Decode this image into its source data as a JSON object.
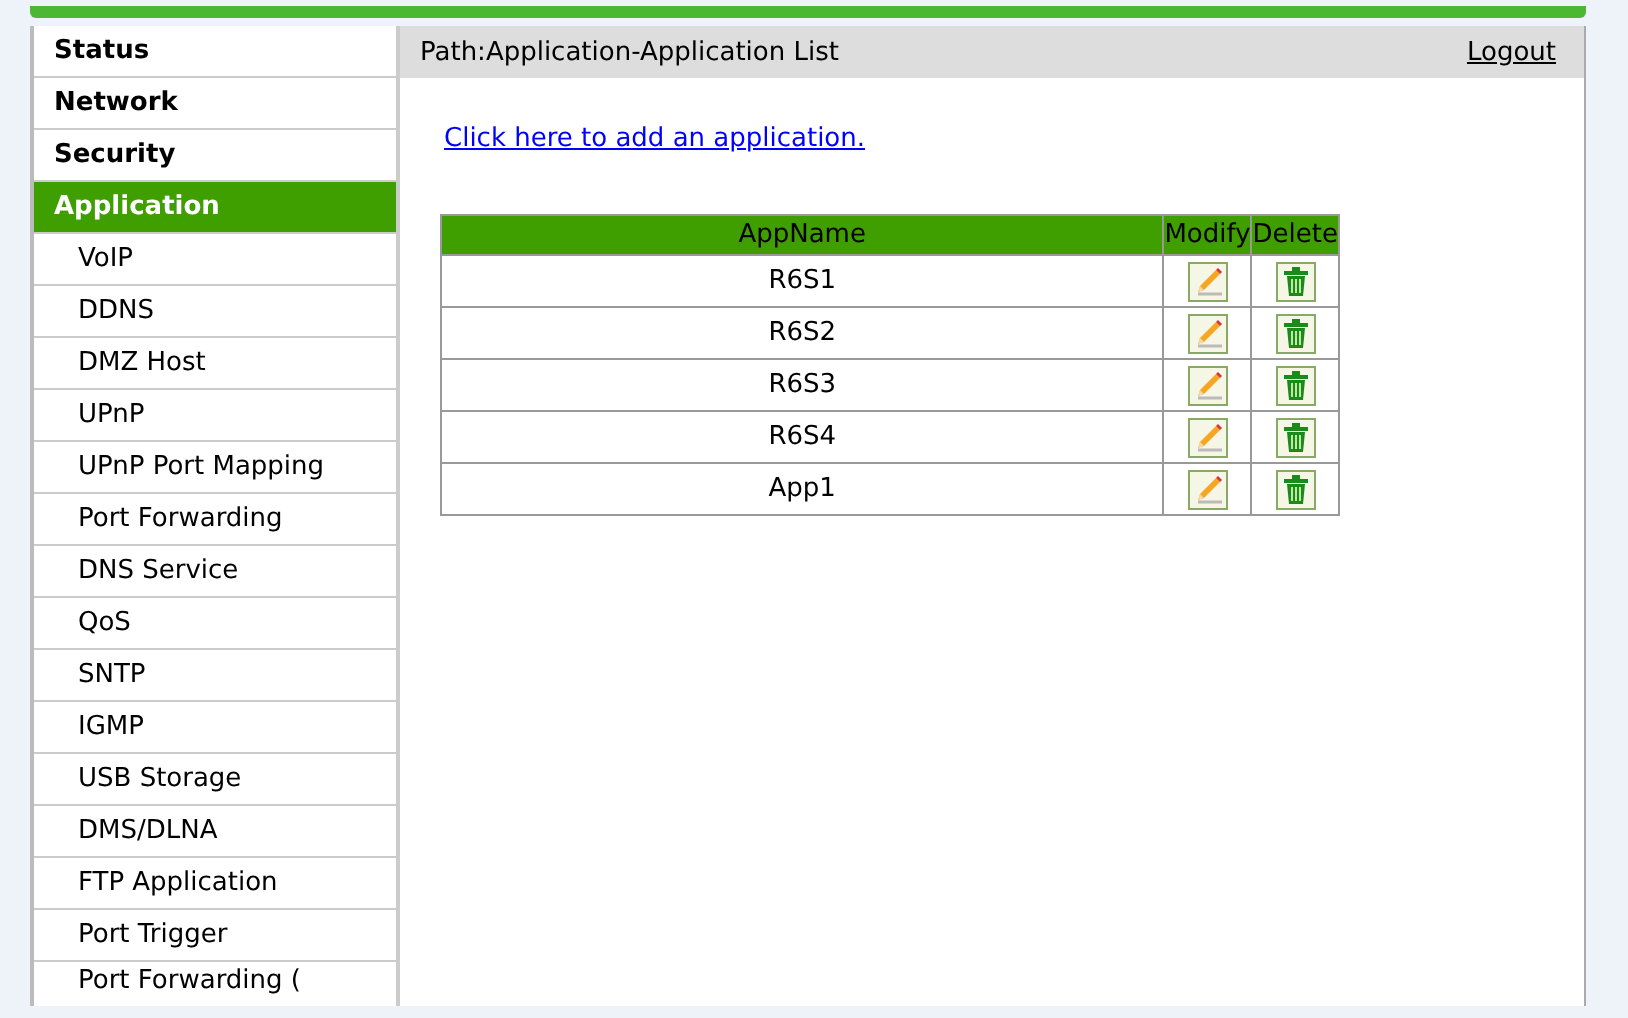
{
  "sidebar": {
    "items": [
      {
        "label": "Status",
        "kind": "section",
        "selected": false
      },
      {
        "label": "Network",
        "kind": "section",
        "selected": false
      },
      {
        "label": "Security",
        "kind": "section",
        "selected": false
      },
      {
        "label": "Application",
        "kind": "section",
        "selected": true
      },
      {
        "label": "VoIP",
        "kind": "sub",
        "selected": false
      },
      {
        "label": "DDNS",
        "kind": "sub",
        "selected": false
      },
      {
        "label": "DMZ Host",
        "kind": "sub",
        "selected": false
      },
      {
        "label": "UPnP",
        "kind": "sub",
        "selected": false
      },
      {
        "label": "UPnP Port Mapping",
        "kind": "sub",
        "selected": false
      },
      {
        "label": "Port Forwarding",
        "kind": "sub",
        "selected": false
      },
      {
        "label": "DNS Service",
        "kind": "sub",
        "selected": false
      },
      {
        "label": "QoS",
        "kind": "sub",
        "selected": false
      },
      {
        "label": "SNTP",
        "kind": "sub",
        "selected": false
      },
      {
        "label": "IGMP",
        "kind": "sub",
        "selected": false
      },
      {
        "label": "USB Storage",
        "kind": "sub",
        "selected": false
      },
      {
        "label": "DMS/DLNA",
        "kind": "sub",
        "selected": false
      },
      {
        "label": "FTP Application",
        "kind": "sub",
        "selected": false
      },
      {
        "label": "Port Trigger",
        "kind": "sub",
        "selected": false
      },
      {
        "label": "Port Forwarding (",
        "kind": "sub",
        "selected": false
      }
    ]
  },
  "header": {
    "path": "Path:Application-Application List",
    "logout": "Logout"
  },
  "add_link": "Click here to add an application.",
  "table": {
    "columns": [
      "AppName",
      "Modify",
      "Delete"
    ],
    "rows": [
      {
        "name": "R6S1"
      },
      {
        "name": "R6S2"
      },
      {
        "name": "R6S3"
      },
      {
        "name": "R6S4"
      },
      {
        "name": "App1"
      }
    ]
  }
}
